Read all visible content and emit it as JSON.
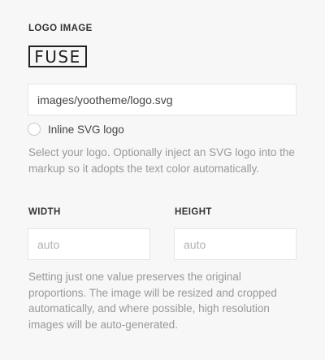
{
  "logo_section": {
    "label": "LOGO IMAGE",
    "preview_text": "FUSE",
    "path_value": "images/yootheme/logo.svg",
    "inline_svg_label": "Inline SVG logo",
    "inline_svg_checked": false,
    "help_text": "Select your logo. Optionally inject an SVG logo into the markup so it adopts the text color automatically."
  },
  "dimensions": {
    "width_label": "WIDTH",
    "width_placeholder": "auto",
    "width_value": "",
    "height_label": "HEIGHT",
    "height_placeholder": "auto",
    "height_value": "",
    "help_text": "Setting just one value preserves the original proportions. The image will be resized and cropped automatically, and where possible, high resolution images will be auto-generated."
  },
  "colors": {
    "background": "#f7f7f7",
    "label": "#333333",
    "help_text": "#999999",
    "input_border": "#e5e5e5"
  }
}
